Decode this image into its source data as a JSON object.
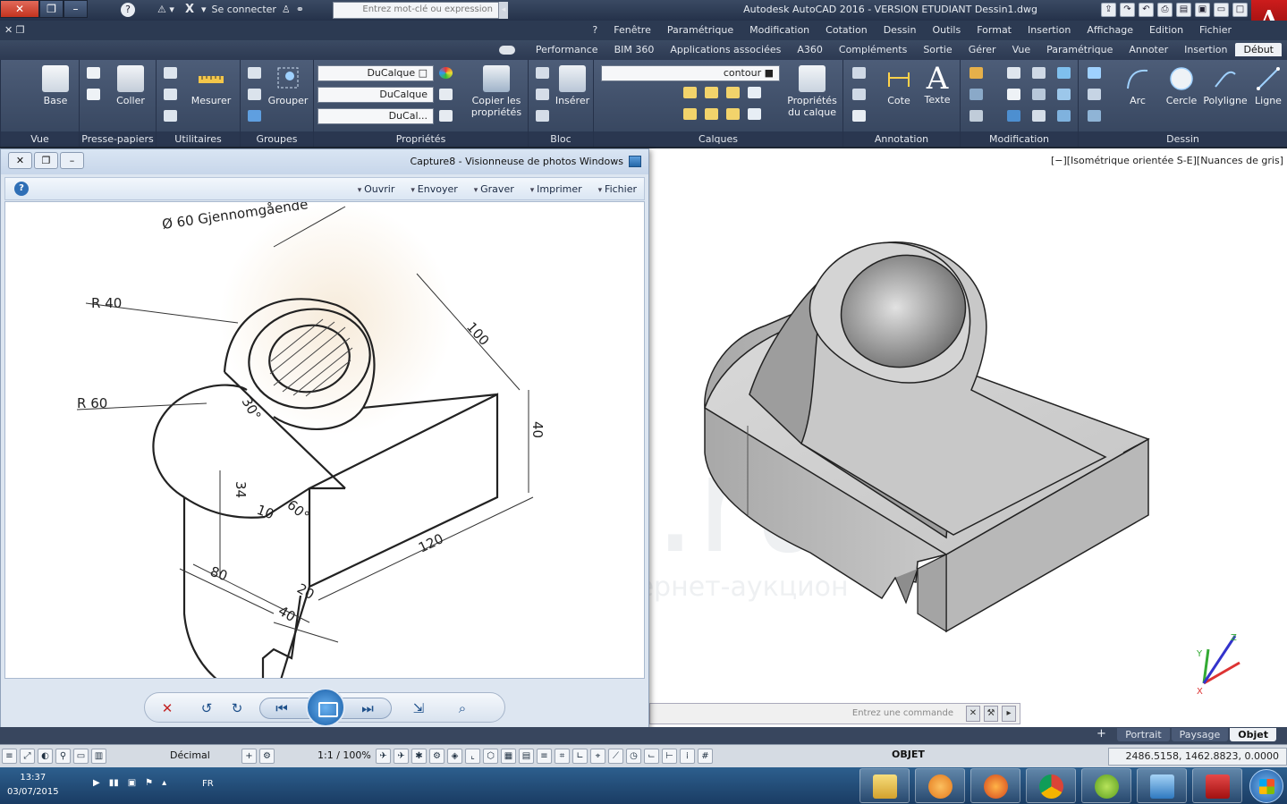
{
  "titlebar": {
    "app_title": "Autodesk AutoCAD 2016 - VERSION ETUDIANT    Dessin1.dwg",
    "search_placeholder": "Entrez mot-clé ou expression",
    "connect_label": "Se connecter"
  },
  "menubar": {
    "items": [
      "Fichier",
      "Edition",
      "Affichage",
      "Insertion",
      "Format",
      "Outils",
      "Dessin",
      "Cotation",
      "Modification",
      "Paramétrique",
      "Fenêtre",
      "?"
    ]
  },
  "ribbon_tabs": {
    "items": [
      "Début",
      "Insertion",
      "Annoter",
      "Paramétrique",
      "Vue",
      "Gérer",
      "Sortie",
      "Compléments",
      "A360",
      "Applications associées",
      "BIM 360",
      "Performance"
    ],
    "active": "Début"
  },
  "ribbon": {
    "panels": {
      "dessin": "Dessin",
      "modification": "Modification",
      "annotation": "Annotation",
      "calques": "Calques",
      "bloc": "Bloc",
      "proprietes": "Propriétés",
      "groupes": "Groupes",
      "utilitaires": "Utilitaires",
      "presse_papiers": "Presse-papiers",
      "vue": "Vue"
    },
    "tools": {
      "ligne": "Ligne",
      "polyligne": "Polyligne",
      "cercle": "Cercle",
      "arc": "Arc",
      "texte": "Texte",
      "cote": "Cote",
      "proprietes_calque": "Propriétés du calque",
      "inserer": "Insérer",
      "copier_proprietes": "Copier les propriétés",
      "grouper": "Grouper",
      "mesurer": "Mesurer",
      "coller": "Coller",
      "base": "Base"
    },
    "layer_combo": "contour",
    "bycolor_combo": "DuCalque",
    "linetype_combo": "DuCalque",
    "lineweight_combo": "DuCal..."
  },
  "viewer": {
    "title": "Capture8 - Visionneuse de photos Windows",
    "menu": [
      "Fichier",
      "Imprimer",
      "Graver",
      "Envoyer",
      "Ouvrir"
    ]
  },
  "viewport": {
    "label": "[−][Isométrique orientée S-E][Nuances de gris]",
    "watermark": "u.ru",
    "watermark_sub": "интернет-аукцион"
  },
  "drawing": {
    "annotations": [
      "Ø 60 Gjennomgående",
      "R 40",
      "R 60",
      "100",
      "40",
      "30°",
      "34",
      "10",
      "60°",
      "120",
      "80",
      "20",
      "40"
    ]
  },
  "command_line": {
    "placeholder": "Entrez une commande"
  },
  "layout_tabs": {
    "items": [
      "Objet",
      "Paysage",
      "Portrait"
    ],
    "active": "Objet"
  },
  "statusbar": {
    "coords": "2486.5158, 1462.8823, 0.0000",
    "space": "OBJET",
    "units": "Décimal",
    "scale": "1:1 / 100%"
  },
  "taskbar": {
    "time": "13:37",
    "date": "03/07/2015",
    "lang": "FR"
  },
  "colors": {
    "autocad_red": "#c21b1b",
    "ribbon_bg": "#3f4e68",
    "model_shade": "#bcbcbc"
  }
}
